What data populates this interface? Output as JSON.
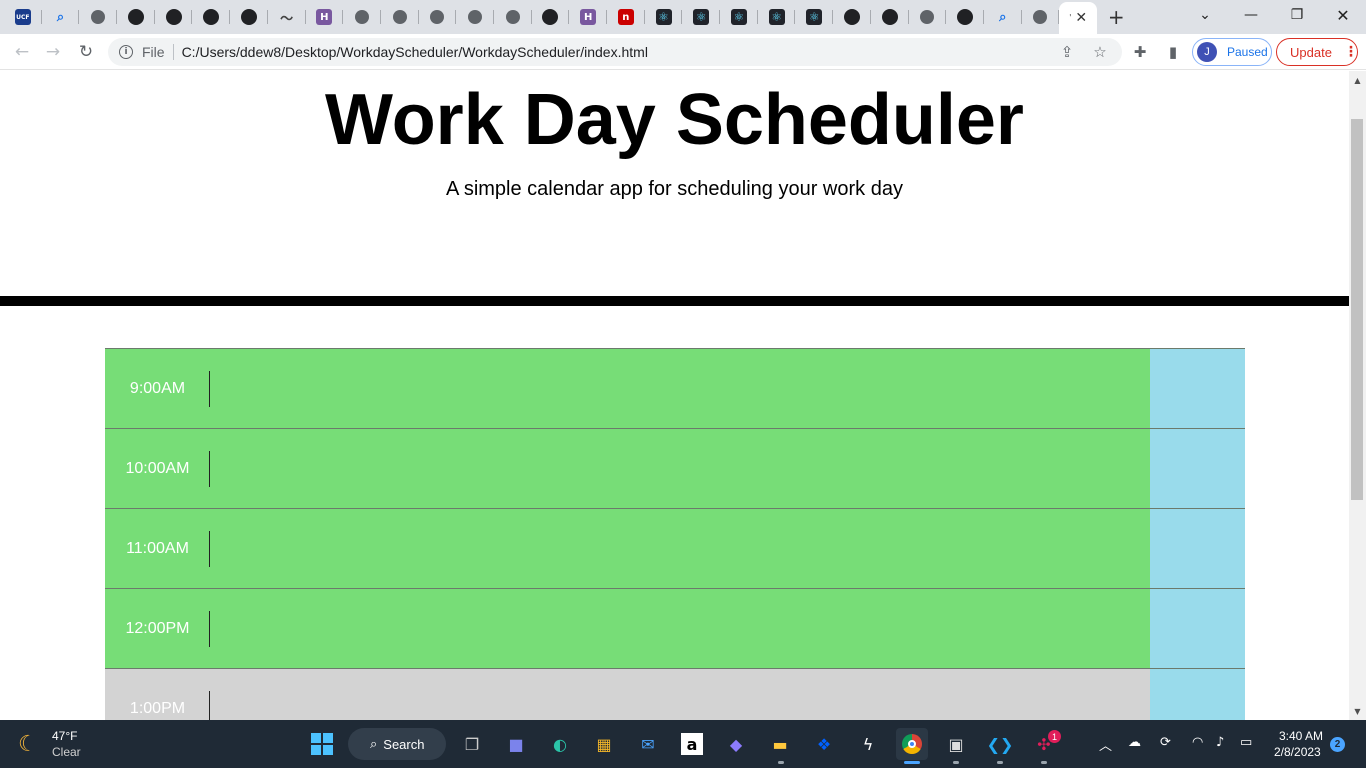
{
  "browser": {
    "tabs": [
      {
        "icon": "ucf-icon",
        "glyph": "UCF",
        "cls": "ucf"
      },
      {
        "icon": "search-icon",
        "glyph": "⌕",
        "cls": "search"
      },
      {
        "icon": "globe-icon",
        "glyph": "",
        "cls": "globe"
      },
      {
        "icon": "github-icon",
        "glyph": "",
        "cls": "github"
      },
      {
        "icon": "github-icon",
        "glyph": "",
        "cls": "github"
      },
      {
        "icon": "github-icon",
        "glyph": "",
        "cls": "github"
      },
      {
        "icon": "github-icon",
        "glyph": "",
        "cls": "github"
      },
      {
        "icon": "squiggle-icon",
        "glyph": "〜",
        "cls": "squig"
      },
      {
        "icon": "heroku-icon",
        "glyph": "H",
        "cls": "heroku"
      },
      {
        "icon": "globe-icon",
        "glyph": "",
        "cls": "globe"
      },
      {
        "icon": "globe-icon",
        "glyph": "",
        "cls": "globe"
      },
      {
        "icon": "globe-icon",
        "glyph": "",
        "cls": "globe"
      },
      {
        "icon": "globe-icon",
        "glyph": "",
        "cls": "globe"
      },
      {
        "icon": "globe-icon",
        "glyph": "",
        "cls": "globe"
      },
      {
        "icon": "github-icon",
        "glyph": "",
        "cls": "github"
      },
      {
        "icon": "heroku-icon",
        "glyph": "H",
        "cls": "heroku"
      },
      {
        "icon": "npm-icon",
        "glyph": "n",
        "cls": "npm"
      },
      {
        "icon": "react-icon",
        "glyph": "⚛",
        "cls": "react"
      },
      {
        "icon": "react-icon",
        "glyph": "⚛",
        "cls": "react"
      },
      {
        "icon": "react-icon",
        "glyph": "⚛",
        "cls": "react"
      },
      {
        "icon": "react-icon",
        "glyph": "⚛",
        "cls": "react"
      },
      {
        "icon": "react-icon",
        "glyph": "⚛",
        "cls": "react"
      },
      {
        "icon": "github-icon",
        "glyph": "",
        "cls": "github"
      },
      {
        "icon": "github-icon",
        "glyph": "",
        "cls": "github"
      },
      {
        "icon": "globe-icon",
        "glyph": "",
        "cls": "globe"
      },
      {
        "icon": "github-icon",
        "glyph": "",
        "cls": "github"
      },
      {
        "icon": "search-icon",
        "glyph": "⌕",
        "cls": "search"
      },
      {
        "icon": "globe-icon",
        "glyph": "",
        "cls": "globe"
      }
    ],
    "active_tab_glyph": "'",
    "close_glyph": "✕",
    "new_tab_glyph": "+",
    "omnibox": {
      "scheme_label": "File",
      "url": "C:/Users/ddew8/Desktop/WorkdayScheduler/WorkdayScheduler/index.html"
    },
    "profile": {
      "initial": "J",
      "status": "Paused"
    },
    "update_label": "Update"
  },
  "page": {
    "title": "Work Day Scheduler",
    "lead": "A simple calendar app for scheduling your work day",
    "hours": [
      {
        "label": "9:00AM",
        "state": "present"
      },
      {
        "label": "10:00AM",
        "state": "present"
      },
      {
        "label": "11:00AM",
        "state": "present"
      },
      {
        "label": "12:00PM",
        "state": "present"
      },
      {
        "label": "1:00PM",
        "state": "past"
      }
    ]
  },
  "colors": {
    "present": "#77dd77",
    "past": "#d3d3d3",
    "save": "#99dbeb"
  },
  "taskbar": {
    "weather": {
      "temp": "47°F",
      "condition": "Clear"
    },
    "search_label": "Search",
    "clock": {
      "time": "3:40 AM",
      "date": "2/8/2023"
    },
    "notification_count": "2",
    "slack_badge": "1"
  }
}
